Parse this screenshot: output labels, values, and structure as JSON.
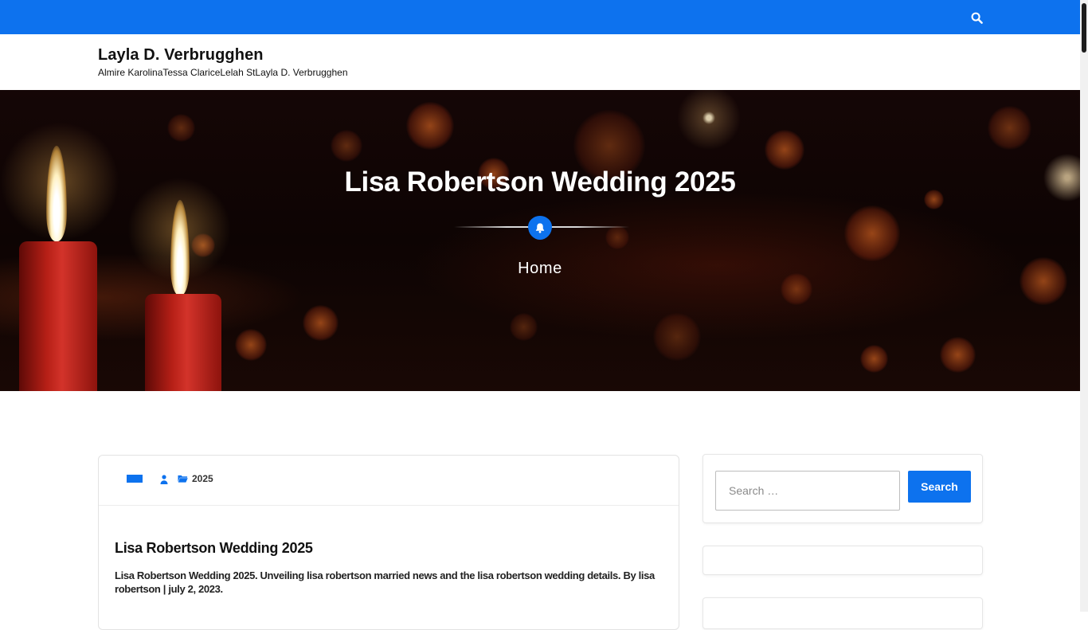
{
  "header": {
    "site_title": "Layla D. Verbrugghen",
    "site_description": "Almire KarolinaTessa ClariceLelah StLayla D. Verbrugghen",
    "search_icon": "search-icon",
    "accent_color": "#0d72ee"
  },
  "hero": {
    "title": "Lisa Robertson Wedding 2025",
    "badge_icon": "bell-icon",
    "breadcrumb": "Home"
  },
  "post": {
    "meta_icons": [
      "flag-icon",
      "user-icon",
      "folder-icon"
    ],
    "category": "2025",
    "title": "Lisa Robertson Wedding 2025",
    "excerpt": "Lisa Robertson Wedding 2025. Unveiling lisa robertson married news and the lisa robertson wedding details. By lisa robertson | july 2, 2023."
  },
  "sidebar": {
    "search": {
      "placeholder": "Search …",
      "button_label": "Search"
    }
  }
}
